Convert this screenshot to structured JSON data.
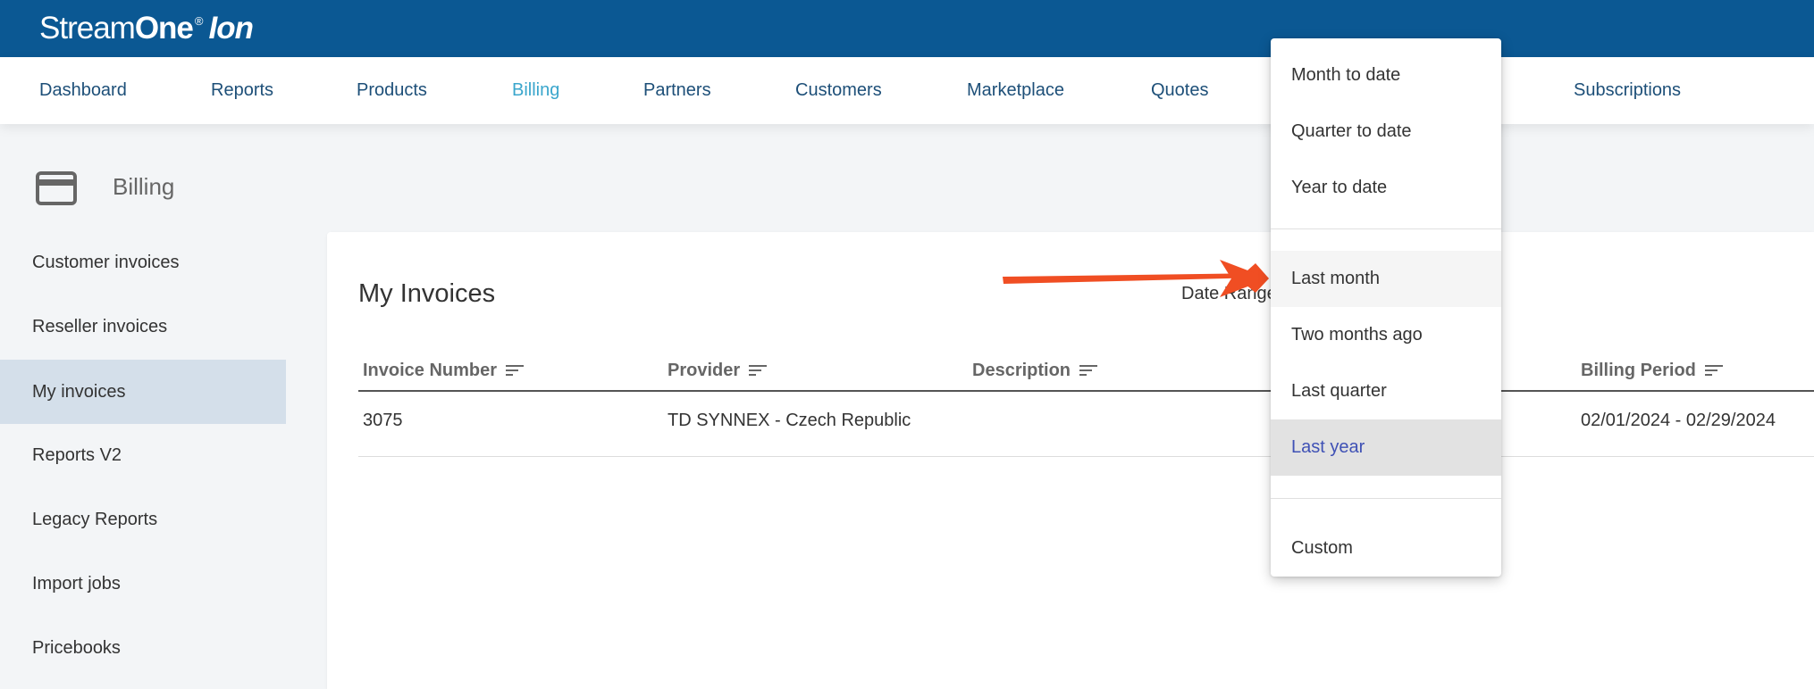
{
  "brand": {
    "part1": "Stream",
    "part2": "One",
    "registered": "®",
    "part3": "Ion"
  },
  "nav": {
    "items": [
      {
        "label": "Dashboard"
      },
      {
        "label": "Reports"
      },
      {
        "label": "Products"
      },
      {
        "label": "Billing"
      },
      {
        "label": "Partners"
      },
      {
        "label": "Customers"
      },
      {
        "label": "Marketplace"
      },
      {
        "label": "Quotes"
      },
      {
        "label": "Subscriptions"
      }
    ],
    "active": "Billing"
  },
  "section": {
    "title": "Billing",
    "icon": "credit-card-icon"
  },
  "sidebar": {
    "items": [
      {
        "label": "Customer invoices"
      },
      {
        "label": "Reseller invoices"
      },
      {
        "label": "My invoices"
      },
      {
        "label": "Reports V2"
      },
      {
        "label": "Legacy Reports"
      },
      {
        "label": "Import jobs"
      },
      {
        "label": "Pricebooks"
      }
    ],
    "selected": "My invoices"
  },
  "main": {
    "title": "My Invoices",
    "date_range_label": "Date Range",
    "table": {
      "columns": [
        "Invoice Number",
        "Provider",
        "Description",
        "Billing Period"
      ],
      "rows": [
        {
          "invoice_number": "3075",
          "provider": "TD SYNNEX - Czech Republic",
          "description": "",
          "billing_period": "02/01/2024 - 02/29/2024"
        }
      ]
    }
  },
  "date_dropdown": {
    "groups": [
      [
        "Month to date",
        "Quarter to date",
        "Year to date"
      ],
      [
        "Last month",
        "Two months ago",
        "Last quarter",
        "Last year"
      ],
      [
        "Custom"
      ]
    ],
    "hovered": "Last month",
    "selected": "Last year"
  },
  "annotation": {
    "type": "arrow",
    "color": "#f04e23",
    "points_to": "Last month"
  },
  "colors": {
    "topbar": "#0b5893",
    "nav_text": "#1d4f78",
    "nav_active": "#3aa6cc",
    "sidebar_selected": "#d4dfea",
    "dropdown_selected_text": "#3f51b5"
  }
}
